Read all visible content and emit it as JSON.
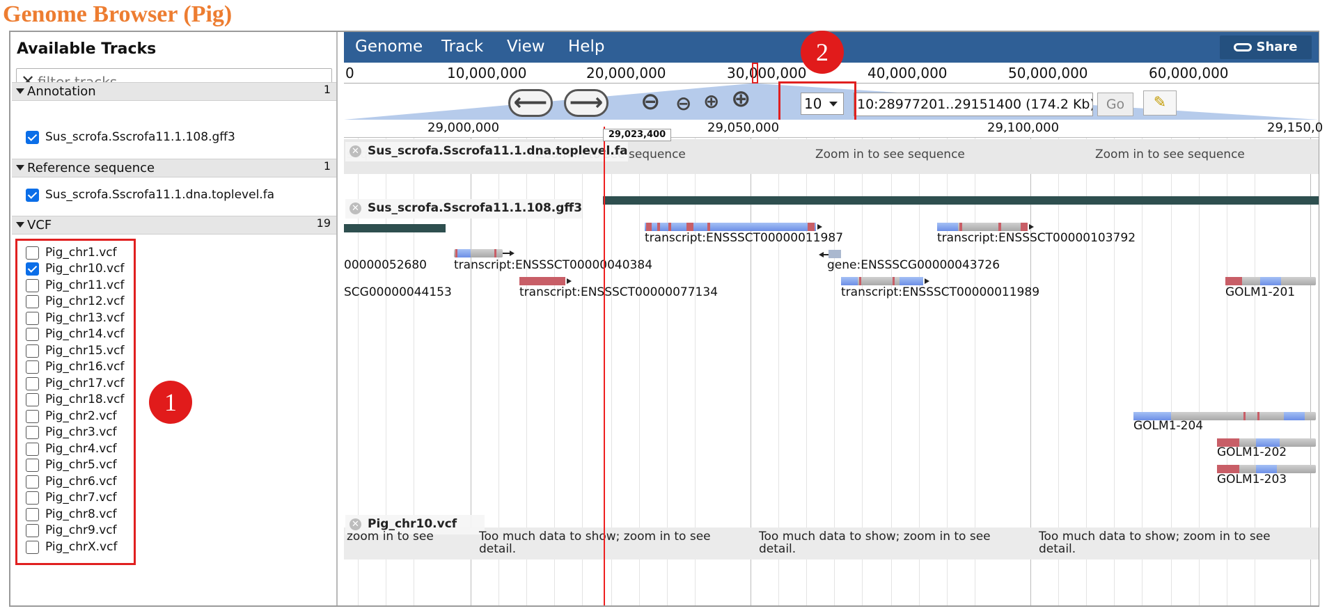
{
  "app_title": "Genome Browser (Pig)",
  "sidebar": {
    "heading": "Available Tracks",
    "filter_placeholder": "filter tracks",
    "categories": [
      {
        "name": "Annotation",
        "count": "1",
        "tracks": [
          {
            "label": "Sus_scrofa.Sscrofa11.1.108.gff3",
            "checked": true
          }
        ]
      },
      {
        "name": "Reference sequence",
        "count": "1",
        "tracks": [
          {
            "label": "Sus_scrofa.Sscrofa11.1.dna.toplevel.fa",
            "checked": true
          }
        ]
      },
      {
        "name": "VCF",
        "count": "19",
        "tracks": [
          {
            "label": "Pig_chr1.vcf",
            "checked": false
          },
          {
            "label": "Pig_chr10.vcf",
            "checked": true
          },
          {
            "label": "Pig_chr11.vcf",
            "checked": false
          },
          {
            "label": "Pig_chr12.vcf",
            "checked": false
          },
          {
            "label": "Pig_chr13.vcf",
            "checked": false
          },
          {
            "label": "Pig_chr14.vcf",
            "checked": false
          },
          {
            "label": "Pig_chr15.vcf",
            "checked": false
          },
          {
            "label": "Pig_chr16.vcf",
            "checked": false
          },
          {
            "label": "Pig_chr17.vcf",
            "checked": false
          },
          {
            "label": "Pig_chr18.vcf",
            "checked": false
          },
          {
            "label": "Pig_chr2.vcf",
            "checked": false
          },
          {
            "label": "Pig_chr3.vcf",
            "checked": false
          },
          {
            "label": "Pig_chr4.vcf",
            "checked": false
          },
          {
            "label": "Pig_chr5.vcf",
            "checked": false
          },
          {
            "label": "Pig_chr6.vcf",
            "checked": false
          },
          {
            "label": "Pig_chr7.vcf",
            "checked": false
          },
          {
            "label": "Pig_chr8.vcf",
            "checked": false
          },
          {
            "label": "Pig_chr9.vcf",
            "checked": false
          },
          {
            "label": "Pig_chrX.vcf",
            "checked": false
          }
        ]
      }
    ]
  },
  "callouts": {
    "one": "1",
    "two": "2"
  },
  "menubar": {
    "items": [
      "Genome",
      "Track",
      "View",
      "Help"
    ],
    "share_label": "Share"
  },
  "overview": {
    "ticks": [
      "0",
      "10,000,000",
      "20,000,000",
      "30,000,000",
      "40,000,000",
      "50,000,000",
      "60,000,000"
    ]
  },
  "navigation": {
    "chromosome": "10",
    "location": "10:28977201..29151400 (174.2 Kb)",
    "go_label": "Go"
  },
  "scale": {
    "ticks": [
      "29,000,000",
      "29,050,000",
      "29,100,000",
      "29,150,0"
    ],
    "cursor_position": "29,023,400"
  },
  "tracks": {
    "reference": {
      "title": "Sus_scrofa.Sscrofa11.1.dna.toplevel.fa",
      "zoom_message": "Zoom in to see sequence",
      "left_fragment": "seque"
    },
    "annotation": {
      "title": "Sus_scrofa.Sscrofa11.1.108.gff3",
      "features": [
        "transcript:ENSSSCT00000011987",
        "transcript:ENSSSCT00000103792",
        "00000052680",
        "transcript:ENSSSCT00000040384",
        "gene:ENSSSCG00000043726",
        "SCG00000044153",
        "transcript:ENSSSCT00000077134",
        "transcript:ENSSSCT00000011989",
        "GOLM1-201",
        "GOLM1-204",
        "GOLM1-202",
        "GOLM1-203"
      ]
    },
    "vcf": {
      "title": "Pig_chr10.vcf",
      "left_fragment": "zoom in to see",
      "message_line1": "Too much data to show; zoom in to see",
      "message_line2": "detail."
    }
  },
  "colors": {
    "title": "#ed7d31",
    "menubar": "#2f5f96",
    "highlight": "#e02020",
    "callout": "#e11b1b"
  }
}
